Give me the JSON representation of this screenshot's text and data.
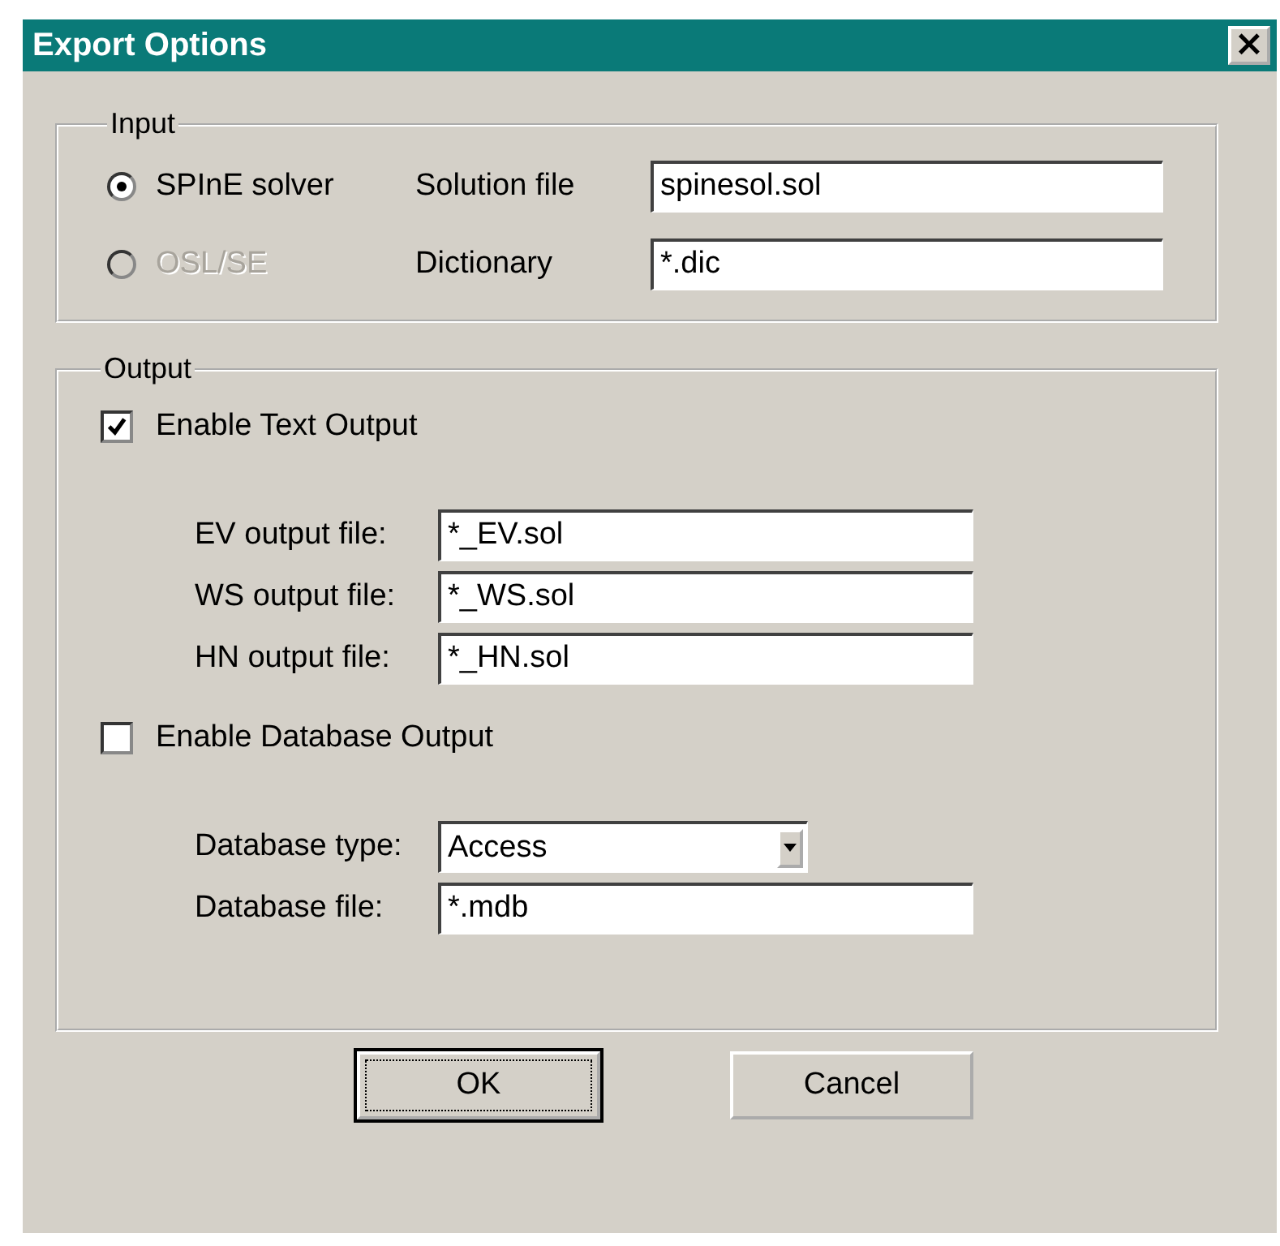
{
  "window": {
    "title": "Export Options",
    "close": "×"
  },
  "input": {
    "legend": "Input",
    "rows": [
      {
        "radio": {
          "label": "SPInE solver",
          "selected": true,
          "disabled": false
        },
        "field": {
          "label": "Solution file",
          "value": "spinesol.sol"
        }
      },
      {
        "radio": {
          "label": "OSL/SE",
          "selected": false,
          "disabled": true
        },
        "field": {
          "label": "Dictionary",
          "value": "*.dic"
        }
      }
    ]
  },
  "output": {
    "legend": "Output",
    "sections": [
      {
        "checkbox": {
          "label": "Enable Text Output",
          "checked": true
        },
        "fields": [
          {
            "kind": "text",
            "label": "EV output file:",
            "value": "*_EV.sol"
          },
          {
            "kind": "text",
            "label": "WS output file:",
            "value": "*_WS.sol"
          },
          {
            "kind": "text",
            "label": "HN output file:",
            "value": "*_HN.sol"
          }
        ]
      },
      {
        "checkbox": {
          "label": "Enable Database Output",
          "checked": false
        },
        "fields": [
          {
            "kind": "dropdown",
            "label": "Database type:",
            "value": "Access"
          },
          {
            "kind": "text",
            "label": "Database file:",
            "value": "*.mdb"
          }
        ]
      }
    ]
  },
  "buttons": [
    {
      "label": "OK",
      "focused": true
    },
    {
      "label": "Cancel",
      "focused": false
    }
  ]
}
